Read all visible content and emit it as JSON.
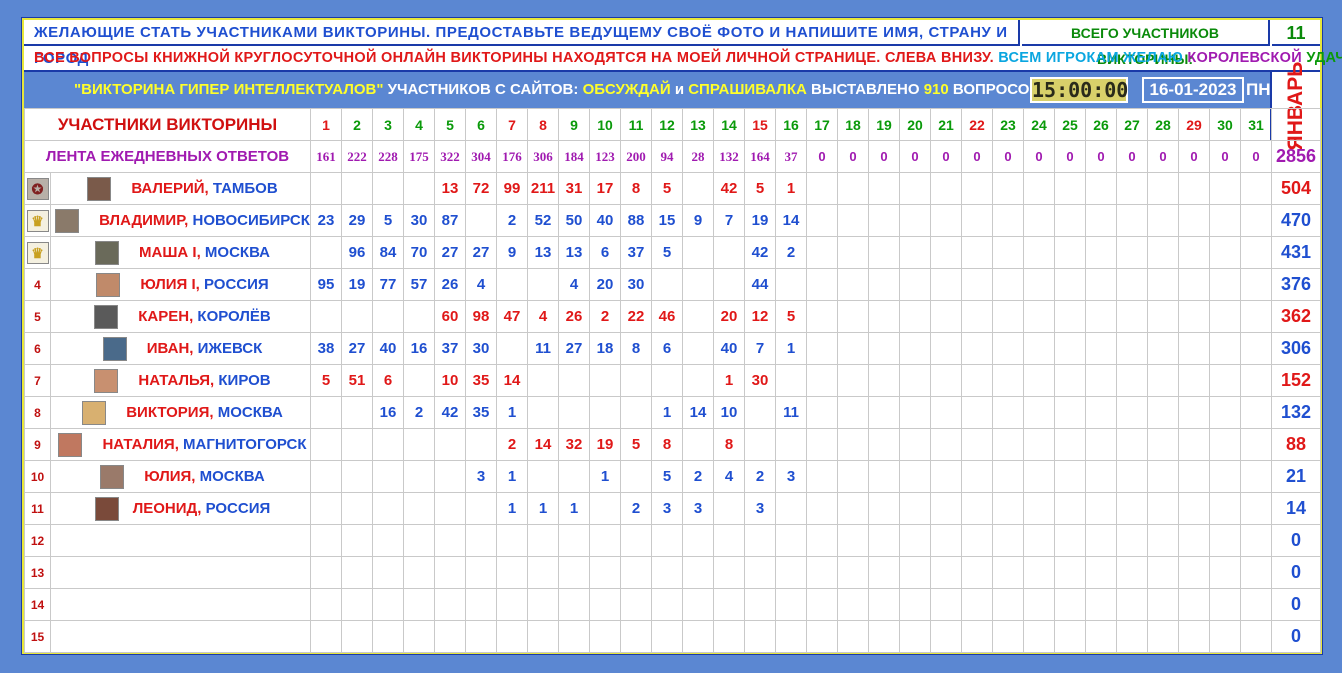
{
  "header": {
    "msg1": "ЖЕЛАЮЩИЕ СТАТЬ УЧАСТНИКАМИ ВИКТОРИНЫ. ПРЕДОСТАВЬТЕ ВЕДУЩЕМУ СВОЁ ФОТО И НАПИШИТЕ ИМЯ, СТРАНУ И ГОРОД",
    "total_label": "ВСЕГО УЧАСТНИКОВ ВИКТОРИНЫ:",
    "total_value": "11",
    "msg2_red": "ВСЕ ВОПРОСЫ КНИЖНОЙ КРУГЛОСУТОЧНОЙ ОНЛАЙН ВИКТОРИНЫ НАХОДЯТСЯ НА МОЕЙ ЛИЧНОЙ СТРАНИЦЕ. СЛЕВА ВНИЗУ.",
    "msg2_cyan": "ВСЕМ ИГРОКАМ ЖЕЛАЮ",
    "msg2_purple": "КОРОЛЕВСКОЙ",
    "msg2_green": "УДАЧИ!",
    "quiz_name": "\"ВИКТОРИНА ГИПЕР ИНТЕЛЛЕКТУАЛОВ\"",
    "info_a": "УЧАСТНИКОВ С САЙТОВ:",
    "site1": "ОБСУЖДАЙ",
    "info_and": "и",
    "site2": "СПРАШИВАЛКА",
    "info_b": "ВЫСТАВЛЕНО",
    "questions": "910",
    "info_c": "ВОПРОСОВ",
    "clock": "15:00:00",
    "date": "16-01-2023",
    "dow": "ПН",
    "month": "ЯНВАРЬ"
  },
  "table": {
    "participants_label": "УЧАСТНИКИ ВИКТОРИНЫ",
    "feed_label": "ЛЕНТА ЕЖЕДНЕВНЫХ ОТВЕТОВ",
    "days": [
      "1",
      "2",
      "3",
      "4",
      "5",
      "6",
      "7",
      "8",
      "9",
      "10",
      "11",
      "12",
      "13",
      "14",
      "15",
      "16",
      "17",
      "18",
      "19",
      "20",
      "21",
      "22",
      "23",
      "24",
      "25",
      "26",
      "27",
      "28",
      "29",
      "30",
      "31"
    ],
    "day_colors": [
      "#e01818",
      "#0a9a0a",
      "#0a9a0a",
      "#0a9a0a",
      "#0a9a0a",
      "#0a9a0a",
      "#e01818",
      "#e01818",
      "#0a9a0a",
      "#0a9a0a",
      "#0a9a0a",
      "#0a9a0a",
      "#0a9a0a",
      "#0a9a0a",
      "#e01818",
      "#0a9a0a",
      "#0a9a0a",
      "#0a9a0a",
      "#0a9a0a",
      "#0a9a0a",
      "#0a9a0a",
      "#e01818",
      "#0a9a0a",
      "#0a9a0a",
      "#0a9a0a",
      "#0a9a0a",
      "#0a9a0a",
      "#0a9a0a",
      "#e01818",
      "#0a9a0a",
      "#0a9a0a"
    ],
    "feed": [
      "161",
      "222",
      "228",
      "175",
      "322",
      "304",
      "176",
      "306",
      "184",
      "123",
      "200",
      "94",
      "28",
      "132",
      "164",
      "37",
      "0",
      "0",
      "0",
      "0",
      "0",
      "0",
      "0",
      "0",
      "0",
      "0",
      "0",
      "0",
      "0",
      "0",
      "0"
    ],
    "feed_total": "2856",
    "rows": [
      {
        "rank": "",
        "badge": "medal",
        "name": "ВАЛЕРИЙ,",
        "city": "ТАМБОВ",
        "color": "red",
        "scores": [
          "",
          "",
          "",
          "",
          "13",
          "72",
          "99",
          "211",
          "31",
          "17",
          "8",
          "5",
          "",
          "42",
          "5",
          "1",
          "",
          "",
          "",
          "",
          "",
          "",
          "",
          "",
          "",
          "",
          "",
          "",
          "",
          "",
          ""
        ],
        "total": "504"
      },
      {
        "rank": "",
        "badge": "crown-2",
        "name": "ВЛАДИМИР,",
        "city": "НОВОСИБИРСК",
        "color": "blue",
        "scores": [
          "23",
          "29",
          "5",
          "30",
          "87",
          "",
          "2",
          "52",
          "50",
          "40",
          "88",
          "15",
          "9",
          "7",
          "19",
          "14",
          "",
          "",
          "",
          "",
          "",
          "",
          "",
          "",
          "",
          "",
          "",
          "",
          "",
          "",
          ""
        ],
        "total": "470"
      },
      {
        "rank": "",
        "badge": "crown-3",
        "name": "МАША I,",
        "city": "МОСКВА",
        "color": "blue",
        "scores": [
          "",
          "96",
          "84",
          "70",
          "27",
          "27",
          "9",
          "13",
          "13",
          "6",
          "37",
          "5",
          "",
          "",
          "42",
          "2",
          "",
          "",
          "",
          "",
          "",
          "",
          "",
          "",
          "",
          "",
          "",
          "",
          "",
          "",
          ""
        ],
        "total": "431"
      },
      {
        "rank": "4",
        "badge": "",
        "name": "ЮЛИЯ I,",
        "city": "РОССИЯ",
        "color": "blue",
        "scores": [
          "95",
          "19",
          "77",
          "57",
          "26",
          "4",
          "",
          "",
          "4",
          "20",
          "30",
          "",
          "",
          "",
          "44",
          "",
          "",
          "",
          "",
          "",
          "",
          "",
          "",
          "",
          "",
          "",
          "",
          "",
          "",
          "",
          ""
        ],
        "total": "376"
      },
      {
        "rank": "5",
        "badge": "",
        "name": "КАРЕН,",
        "city": "КОРОЛЁВ",
        "color": "red",
        "scores": [
          "",
          "",
          "",
          "",
          "60",
          "98",
          "47",
          "4",
          "26",
          "2",
          "22",
          "46",
          "",
          "20",
          "12",
          "5",
          "",
          "",
          "",
          "",
          "",
          "",
          "",
          "",
          "",
          "",
          "",
          "",
          "",
          "",
          ""
        ],
        "total": "362"
      },
      {
        "rank": "6",
        "badge": "",
        "name": "ИВАН,",
        "city": "ИЖЕВСК",
        "color": "blue",
        "scores": [
          "38",
          "27",
          "40",
          "16",
          "37",
          "30",
          "",
          "11",
          "27",
          "18",
          "8",
          "6",
          "",
          "40",
          "7",
          "1",
          "",
          "",
          "",
          "",
          "",
          "",
          "",
          "",
          "",
          "",
          "",
          "",
          "",
          "",
          ""
        ],
        "total": "306"
      },
      {
        "rank": "7",
        "badge": "",
        "name": "НАТАЛЬЯ,",
        "city": "КИРОВ",
        "color": "red",
        "scores": [
          "5",
          "51",
          "6",
          "",
          "10",
          "35",
          "14",
          "",
          "",
          "",
          "",
          "",
          "",
          "1",
          "30",
          "",
          "",
          "",
          "",
          "",
          "",
          "",
          "",
          "",
          "",
          "",
          "",
          "",
          "",
          "",
          ""
        ],
        "total": "152"
      },
      {
        "rank": "8",
        "badge": "",
        "name": "ВИКТОРИЯ,",
        "city": "МОСКВА",
        "color": "blue",
        "scores": [
          "",
          "",
          "16",
          "2",
          "42",
          "35",
          "1",
          "",
          "",
          "",
          "",
          "1",
          "14",
          "10",
          "",
          "11",
          "",
          "",
          "",
          "",
          "",
          "",
          "",
          "",
          "",
          "",
          "",
          "",
          "",
          "",
          ""
        ],
        "total": "132"
      },
      {
        "rank": "9",
        "badge": "",
        "name": "НАТАЛИЯ,",
        "city": "МАГНИТОГОРСК",
        "color": "red",
        "scores": [
          "",
          "",
          "",
          "",
          "",
          "",
          "2",
          "14",
          "32",
          "19",
          "5",
          "8",
          "",
          "8",
          "",
          "",
          "",
          "",
          "",
          "",
          "",
          "",
          "",
          "",
          "",
          "",
          "",
          "",
          "",
          "",
          ""
        ],
        "total": "88"
      },
      {
        "rank": "10",
        "badge": "",
        "name": "ЮЛИЯ,",
        "city": "МОСКВА",
        "color": "blue",
        "scores": [
          "",
          "",
          "",
          "",
          "",
          "3",
          "1",
          "",
          "",
          "1",
          "",
          "5",
          "2",
          "4",
          "2",
          "3",
          "",
          "",
          "",
          "",
          "",
          "",
          "",
          "",
          "",
          "",
          "",
          "",
          "",
          "",
          ""
        ],
        "total": "21"
      },
      {
        "rank": "11",
        "badge": "",
        "name": "ЛЕОНИД,",
        "city": "РОССИЯ",
        "color": "blue",
        "scores": [
          "",
          "",
          "",
          "",
          "",
          "",
          "1",
          "1",
          "1",
          "",
          "2",
          "3",
          "3",
          "",
          "3",
          "",
          "",
          "",
          "",
          "",
          "",
          "",
          "",
          "",
          "",
          "",
          "",
          "",
          "",
          "",
          ""
        ],
        "total": "14"
      },
      {
        "rank": "12",
        "badge": "",
        "name": "",
        "city": "",
        "color": "blue",
        "scores": [
          "",
          "",
          "",
          "",
          "",
          "",
          "",
          "",
          "",
          "",
          "",
          "",
          "",
          "",
          "",
          "",
          "",
          "",
          "",
          "",
          "",
          "",
          "",
          "",
          "",
          "",
          "",
          "",
          "",
          "",
          ""
        ],
        "total": "0"
      },
      {
        "rank": "13",
        "badge": "",
        "name": "",
        "city": "",
        "color": "blue",
        "scores": [
          "",
          "",
          "",
          "",
          "",
          "",
          "",
          "",
          "",
          "",
          "",
          "",
          "",
          "",
          "",
          "",
          "",
          "",
          "",
          "",
          "",
          "",
          "",
          "",
          "",
          "",
          "",
          "",
          "",
          "",
          ""
        ],
        "total": "0"
      },
      {
        "rank": "14",
        "badge": "",
        "name": "",
        "city": "",
        "color": "blue",
        "scores": [
          "",
          "",
          "",
          "",
          "",
          "",
          "",
          "",
          "",
          "",
          "",
          "",
          "",
          "",
          "",
          "",
          "",
          "",
          "",
          "",
          "",
          "",
          "",
          "",
          "",
          "",
          "",
          "",
          "",
          "",
          ""
        ],
        "total": "0"
      },
      {
        "rank": "15",
        "badge": "",
        "name": "",
        "city": "",
        "color": "blue",
        "scores": [
          "",
          "",
          "",
          "",
          "",
          "",
          "",
          "",
          "",
          "",
          "",
          "",
          "",
          "",
          "",
          "",
          "",
          "",
          "",
          "",
          "",
          "",
          "",
          "",
          "",
          "",
          "",
          "",
          "",
          "",
          ""
        ],
        "total": "0"
      }
    ],
    "total_colors": [
      "#e01818",
      "#1f4fd0",
      "#1f4fd0",
      "#1f4fd0",
      "#e01818",
      "#1f4fd0",
      "#e01818",
      "#1f4fd0",
      "#e01818",
      "#1f4fd0",
      "#1f4fd0",
      "#1f4fd0",
      "#1f4fd0",
      "#1f4fd0",
      "#1f4fd0"
    ]
  },
  "colors": {
    "accent": "#5b87d2",
    "frame": "#e6e63a",
    "red": "#e01818",
    "blue": "#1f4fd0",
    "green": "#0a9a0a",
    "purple": "#a01ab0"
  }
}
